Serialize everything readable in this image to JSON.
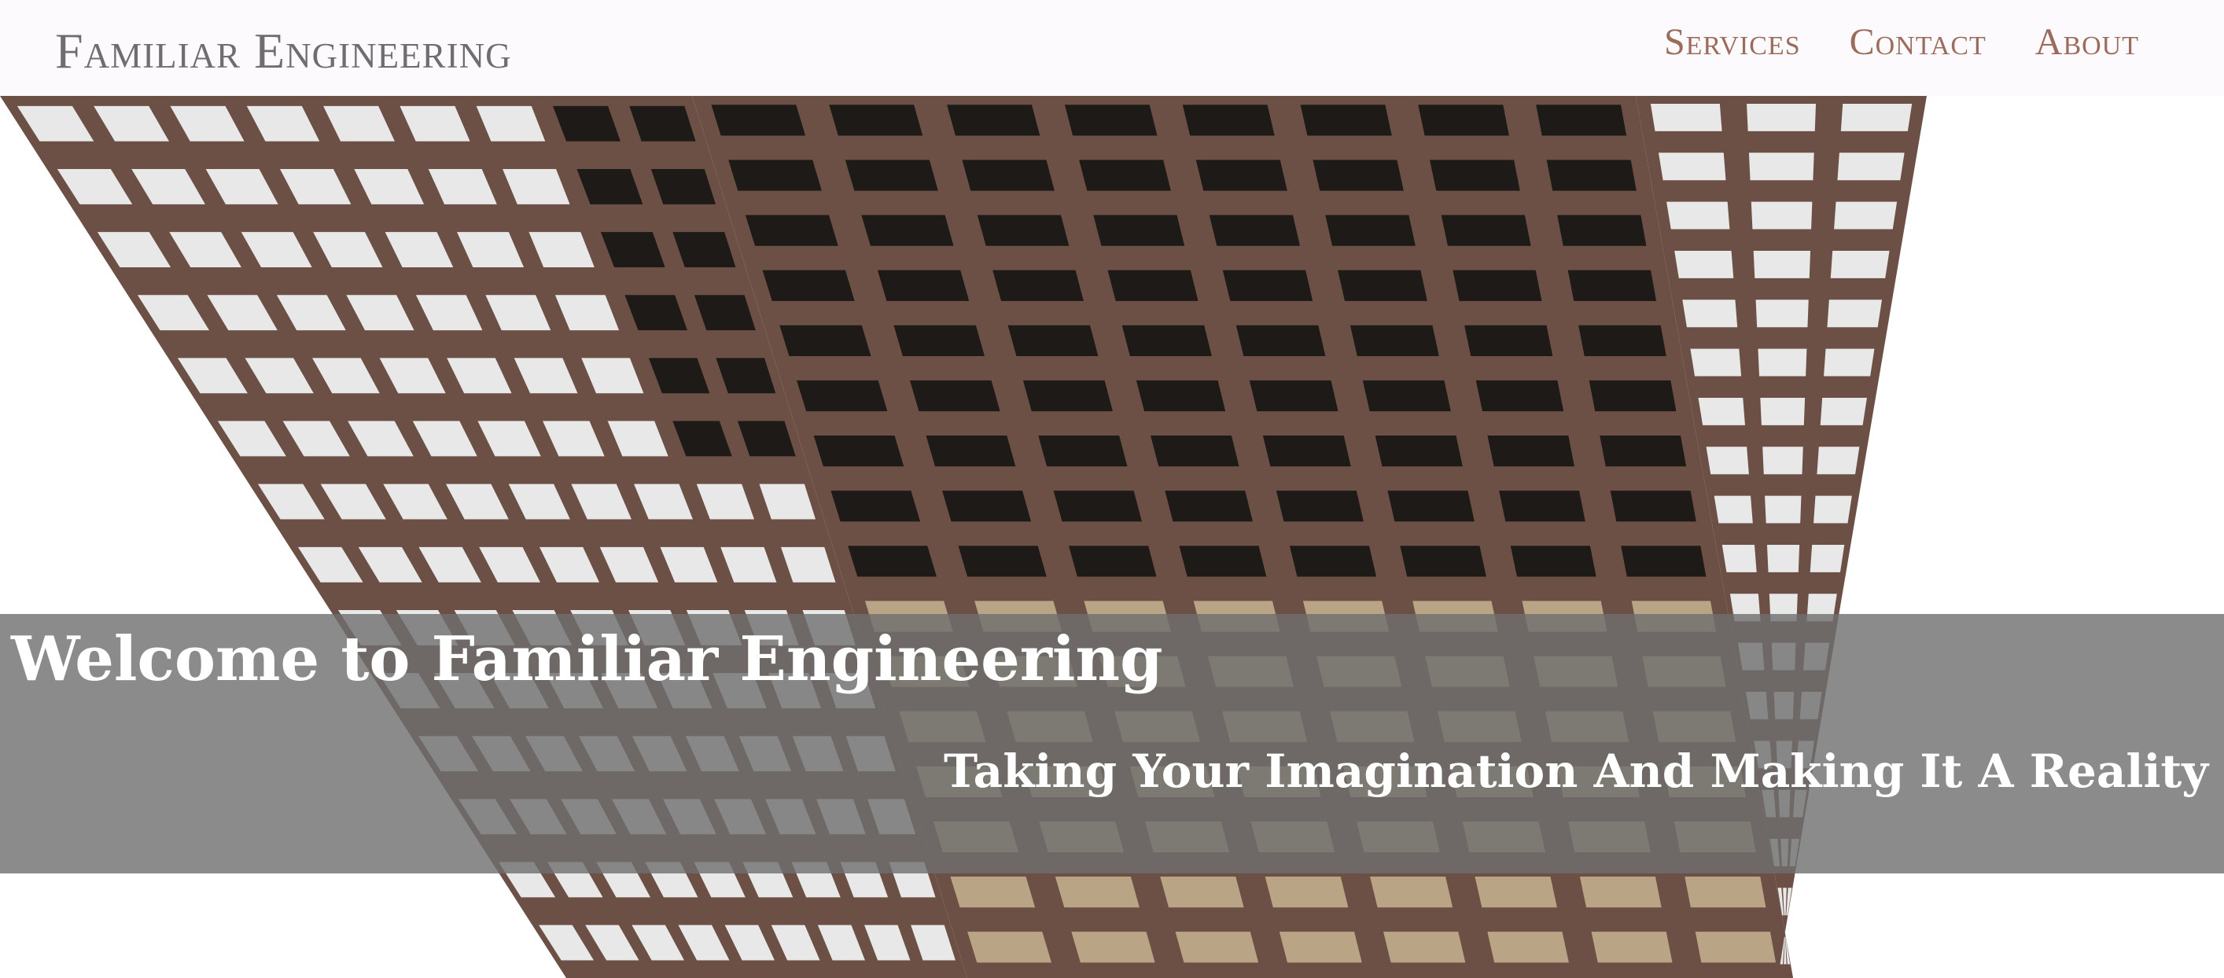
{
  "header": {
    "brand": "Familiar Engineering",
    "nav": [
      "Services",
      "Contact",
      "About"
    ]
  },
  "hero": {
    "title": "Welcome to Familiar Engineering",
    "subtitle": "Taking Your Imagination And Making It A Reality",
    "image_description_icon": "building-photo"
  },
  "colors": {
    "header_bg": "#fdfafd",
    "brand_text": "#6e6e6e",
    "nav_text": "#9b6b5c",
    "overlay": "rgba(110,110,110,0.80)",
    "facade": "#6d5045",
    "window_glass": "#e8e8e8",
    "window_dark": "#1e1a17"
  }
}
